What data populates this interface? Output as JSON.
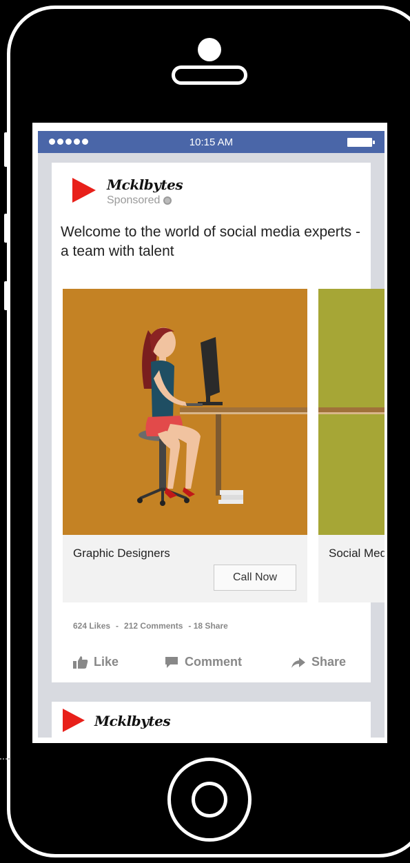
{
  "status_bar": {
    "time": "10:15 AM"
  },
  "post": {
    "brand": "Mcklbytes",
    "sponsored": "Sponsored",
    "text": "Welcome to the world of social media experts - a team with talent",
    "cards": [
      {
        "title": "Graphic Designers",
        "button": "Call Now"
      },
      {
        "title": "Social Media I"
      }
    ],
    "stats": {
      "likes": "624 Likes",
      "sep1": "-",
      "comments": "212 Comments",
      "shares": "- 18 Share"
    },
    "actions": {
      "like": "Like",
      "comment": "Comment",
      "share": "Share"
    }
  },
  "post2": {
    "brand": "Mcklbytes"
  },
  "colors": {
    "facebook_blue": "#4a66a8",
    "brand_red": "#e8201a",
    "card_orange": "#c48224",
    "card_green": "#a6a636"
  },
  "icons": [
    "thumbs-up-icon",
    "comment-icon",
    "share-arrow-icon",
    "globe-icon",
    "play-logo-icon"
  ]
}
